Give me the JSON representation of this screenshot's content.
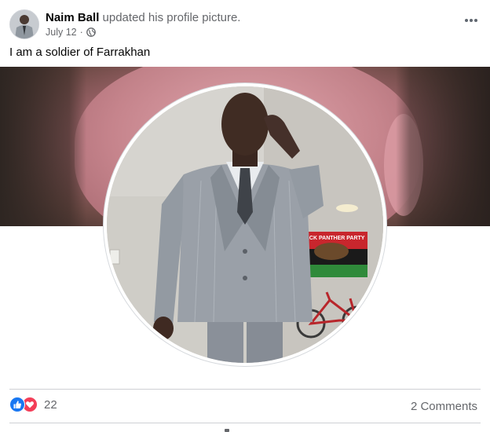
{
  "post": {
    "author_name": "Naim Ball",
    "action_text": " updated his profile picture.",
    "date": "July 12",
    "separator": "·",
    "caption": "I am a soldier of Farrakhan",
    "more_icon": "more-horizontal-icon",
    "privacy_icon": "globe-icon"
  },
  "profile_picture": {
    "banner_text": "BLACK PANTHER PARTY"
  },
  "footer": {
    "reaction_icons": [
      "like-icon",
      "love-icon"
    ],
    "reaction_count": "22",
    "comments_label": "2 Comments"
  },
  "colors": {
    "like": "#1877f2",
    "love": "#f33e58",
    "secondary_text": "#65676b",
    "divider": "#ced0d4"
  }
}
